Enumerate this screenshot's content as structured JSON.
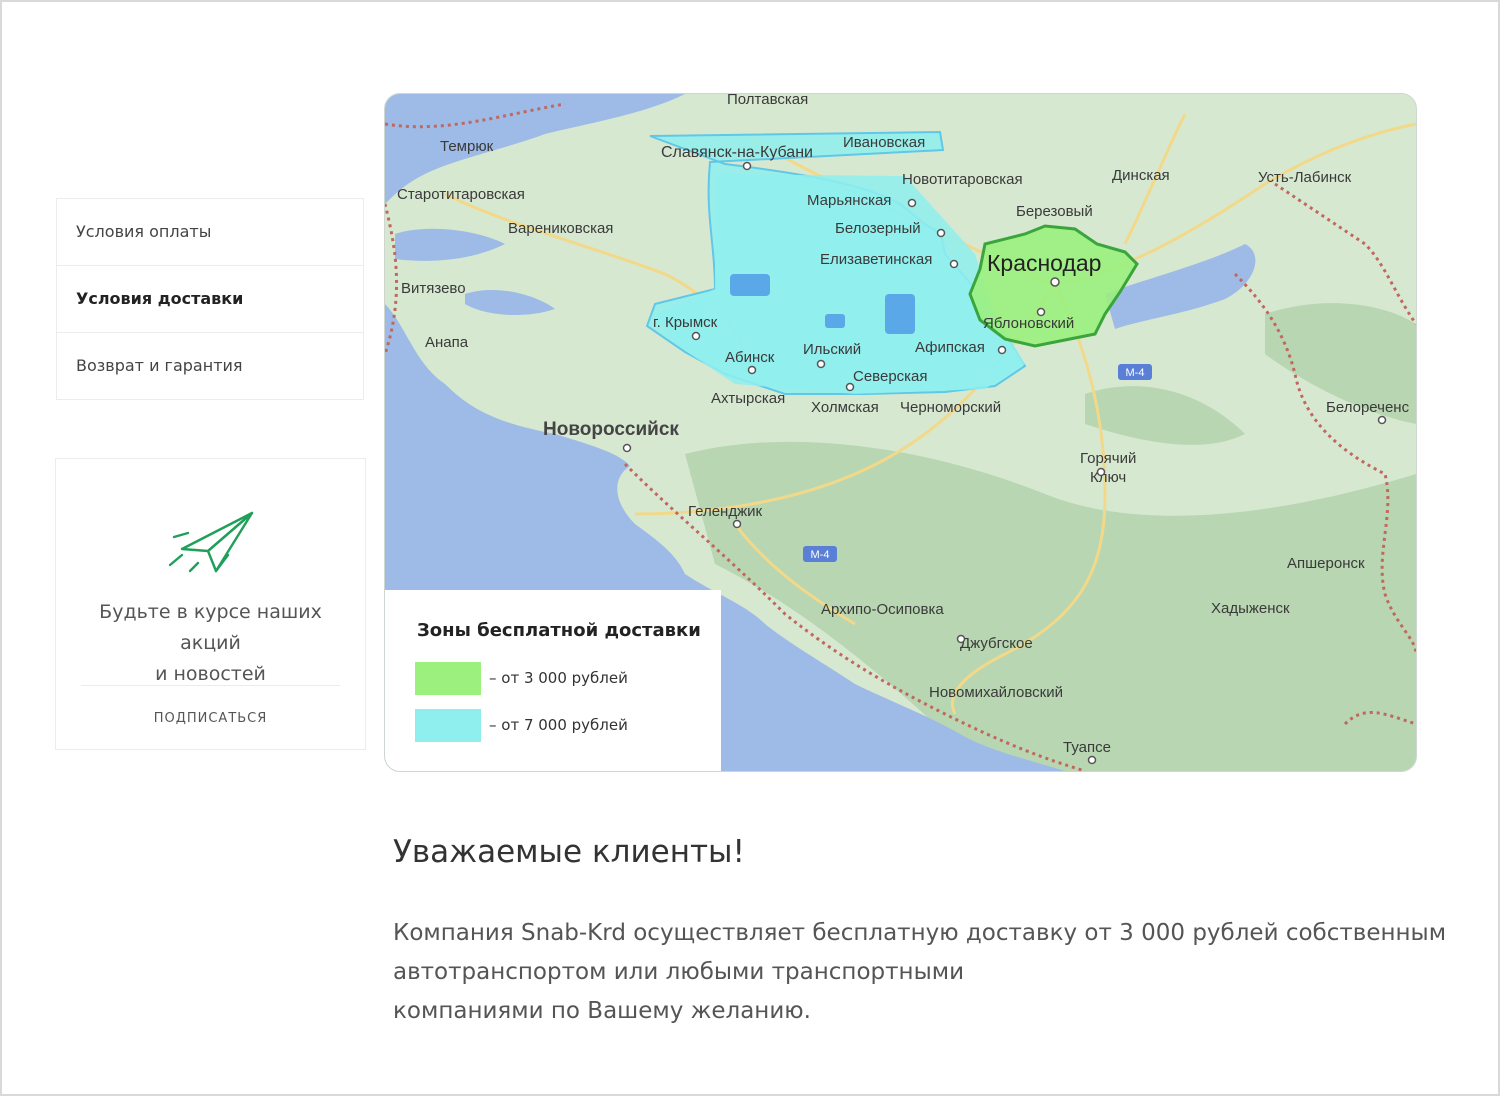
{
  "sidebar": {
    "items": [
      {
        "label": "Условия оплаты",
        "active": false
      },
      {
        "label": "Условия доставки",
        "active": true
      },
      {
        "label": "Возврат и гарантия",
        "active": false
      }
    ]
  },
  "subscribe": {
    "icon": "paper-plane-icon",
    "text_line1": "Будьте в курсе наших акций",
    "text_line2": "и новостей",
    "button_label": "ПОДПИСАТЬСЯ"
  },
  "map": {
    "cities": {
      "poltavskaya": "Полтавская",
      "temryuk": "Темрюк",
      "slavyansk": "Славянск-на-Кубани",
      "ivanovskaya": "Ивановская",
      "novotitarovskaya": "Новотитаровская",
      "dinskaya": "Динская",
      "ust_labinsk": "Усть-Лабинск",
      "starotitarovskaya": "Старотитаровская",
      "marianskaya": "Марьянская",
      "berezovy": "Березовый",
      "varenikovskaya": "Варениковская",
      "belozerny": "Белозерный",
      "elizavetinskaya": "Елизаветинская",
      "krasnodar": "Краснодар",
      "vityazevo": "Витязево",
      "yablonovsky": "Яблоновский",
      "krymsk": "г. Крымск",
      "anapa": "Анапа",
      "abinsk": "Абинск",
      "ilsky": "Ильский",
      "afipskaya": "Афипская",
      "severskaya": "Северская",
      "akhtyrskaya": "Ахтырская",
      "kholmskaya": "Холмская",
      "chernomorsky": "Черноморский",
      "belorechensk": "Белореченс",
      "novorossiysk": "Новороссийск",
      "goryachy_klyuch_1": "Горячий",
      "goryachy_klyuch_2": "Ключ",
      "gelendzhik": "Геленджик",
      "apsheronsk": "Апшеронск",
      "arkhipo": "Архипо-Осиповка",
      "khadyzhensk": "Хадыженск",
      "dzhubga": "Джубгское",
      "novomikhailovsky": "Новомихайловский",
      "tuapse": "Туапсе",
      "m4": "М-4"
    },
    "colors": {
      "land": "#d7e8d1",
      "forest": "#b9d7b3",
      "sea": "#9dbbe6",
      "zone_green": "#9bf07e",
      "zone_cyan": "#8fefef",
      "road": "#f2d98a",
      "border": "#c0675f"
    },
    "legend": {
      "title": "Зоны бесплатной доставки",
      "items": [
        {
          "label": "– от 3 000 рублей",
          "color": "#9bf07e"
        },
        {
          "label": "– от 7 000 рублей",
          "color": "#8fefef"
        }
      ]
    }
  },
  "content": {
    "heading": "Уважаемые клиенты!",
    "para_line1": "Компания Snab-Krd осуществляет бесплатную доставку от 3 000 рублей собственным",
    "para_line2": "автотранспортом или любыми транспортными",
    "para_line3": "компаниями по Вашему желанию."
  }
}
